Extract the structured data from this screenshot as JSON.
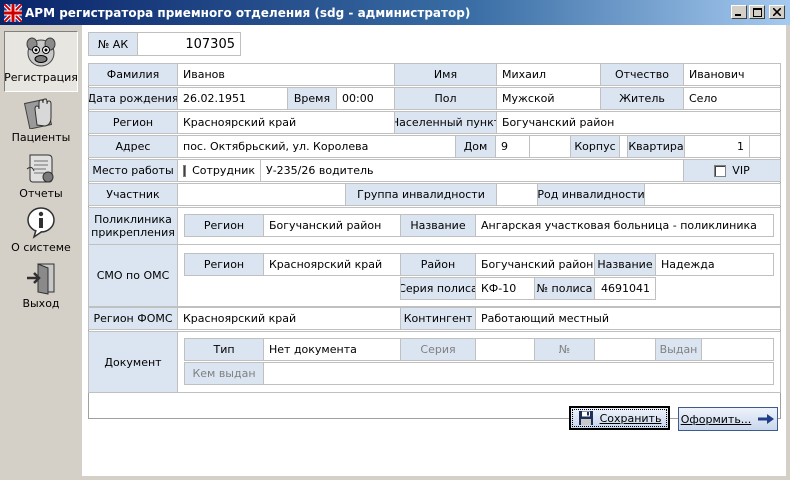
{
  "window": {
    "title": "АРМ регистратора приемного отделения (sdg - администратор)"
  },
  "sidebar": {
    "items": [
      {
        "label": "Регистрация",
        "icon": "registration-face-icon",
        "active": true
      },
      {
        "label": "Пациенты",
        "icon": "patients-hand-icon"
      },
      {
        "label": "Отчеты",
        "icon": "reports-scroll-icon"
      },
      {
        "label": "О системе",
        "icon": "info-icon"
      },
      {
        "label": "Выход",
        "icon": "exit-door-icon"
      }
    ]
  },
  "form": {
    "ak": {
      "label": "№ АК",
      "value": "107305"
    },
    "surname": {
      "label": "Фамилия",
      "value": "Иванов"
    },
    "name": {
      "label": "Имя",
      "value": "Михаил"
    },
    "patronymic": {
      "label": "Отчество",
      "value": "Иванович"
    },
    "birth_date": {
      "label": "Дата рождения",
      "value": "26.02.1951"
    },
    "time": {
      "label": "Время",
      "value": "00:00"
    },
    "sex": {
      "label": "Пол",
      "value": "Мужской"
    },
    "resident": {
      "label": "Житель",
      "value": "Село"
    },
    "region": {
      "label": "Регион",
      "value": "Красноярский край"
    },
    "settlement": {
      "label": "Населенный пункт",
      "value": "Богучанский район"
    },
    "address": {
      "label": "Адрес",
      "value": "пос. Октябрьский,  ул. Королева"
    },
    "house": {
      "label": "Дом",
      "value": "9"
    },
    "building": {
      "label": "Корпус",
      "value": ""
    },
    "apartment": {
      "label": "Квартира",
      "value": "1"
    },
    "workplace": {
      "label": "Место работы",
      "employee_label": "Сотрудник",
      "value": "У-235/26 водитель"
    },
    "vip": {
      "label": "VIP"
    },
    "participant": {
      "label": "Участник",
      "value": ""
    },
    "disability_group": {
      "label": "Группа инвалидности",
      "value": ""
    },
    "disability_kind": {
      "label": "Род инвалидности",
      "value": ""
    },
    "clinic": {
      "label": "Поликлиника прикрепления",
      "region_label": "Регион",
      "region_value": "Богучанский район",
      "name_label": "Название",
      "name_value": "Ангарская участковая больница - поликлиника"
    },
    "smo": {
      "label": "СМО по ОМС",
      "region_label": "Регион",
      "region_value": "Красноярский край",
      "district_label": "Район",
      "district_value": "Богучанский район",
      "name_label": "Название",
      "name_value": "Надежда",
      "policy_series_label": "Серия полиса",
      "policy_series_value": "КФ-10",
      "policy_number_label": "№ полиса",
      "policy_number_value": "4691041"
    },
    "foms_region": {
      "label": "Регион ФОМС",
      "value": "Красноярский край"
    },
    "contingent": {
      "label": "Контингент",
      "value": "Работающий местный"
    },
    "document": {
      "label": "Документ",
      "type_label": "Тип",
      "type_value": "Нет документа",
      "series_label": "Серия",
      "series_value": "",
      "number_label": "№",
      "number_value": "",
      "issued_label": "Выдан",
      "issued_value": "",
      "issued_by_label": "Кем выдан",
      "issued_by_value": ""
    }
  },
  "buttons": {
    "save": "Сохранить",
    "process": "Оформить..."
  },
  "colors": {
    "label_bg": "#dbe5f1",
    "title_bar": "#0a246a",
    "button_border": "#3c5a8c"
  }
}
